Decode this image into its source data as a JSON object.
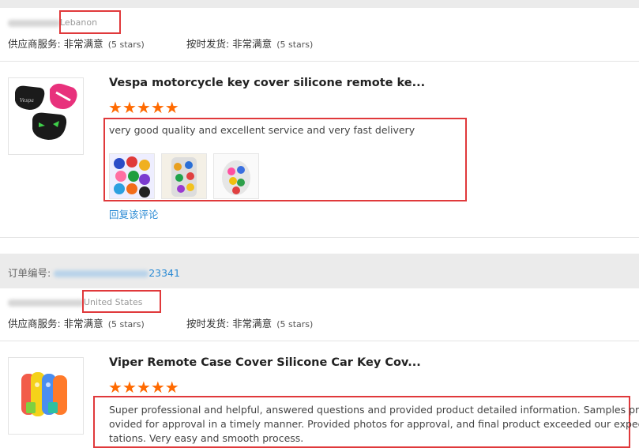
{
  "reviews": [
    {
      "country": "Lebanon",
      "supplier_service_label": "供应商服务: 非常满意",
      "supplier_service_stars": "(5 stars)",
      "delivery_label": "按时发货: 非常满意",
      "delivery_stars": "(5 stars)",
      "product_title": "Vespa motorcycle key cover silicone remote ke...",
      "rating": 5,
      "review_text": "very good quality and excellent service and very fast delivery",
      "photo_count": 3,
      "reply_link": "回复该评论"
    },
    {
      "order_label": "订单编号:",
      "order_number_suffix": "23341",
      "country": "United States",
      "supplier_service_label": "供应商服务: 非常满意",
      "supplier_service_stars": "(5 stars)",
      "delivery_label": "按时发货: 非常满意",
      "delivery_stars": "(5 stars)",
      "product_title": "Viper Remote Case Cover Silicone Car Key Cov...",
      "rating": 5,
      "review_text_lines": [
        "Super professional and helpful, answered questions and provided product detailed information. Samples pr",
        "ovided for approval in a timely manner. Provided photos for approval, and final product exceeded our expec",
        "tations. Very easy and smooth process."
      ]
    }
  ],
  "colors": {
    "star": "#ff6a00",
    "highlight_box": "#e0393b",
    "link": "#2a8ad4"
  }
}
